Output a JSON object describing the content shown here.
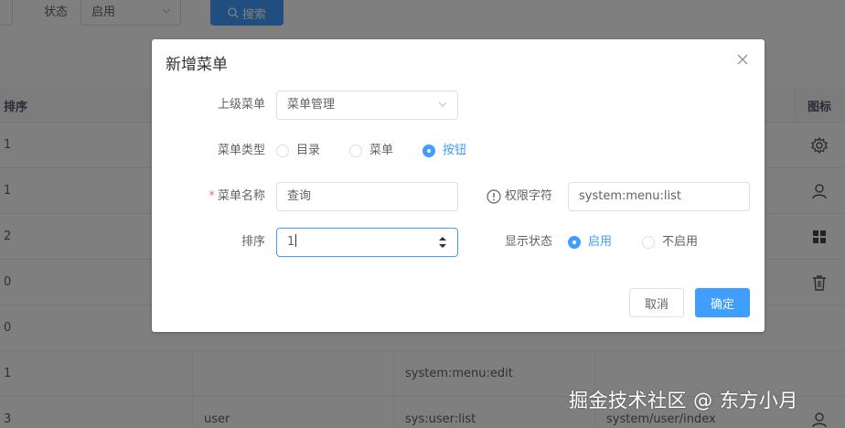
{
  "filter": {
    "status_label": "状态",
    "status_value": "启用",
    "search_label": "搜索"
  },
  "table": {
    "headers": {
      "order": "排序",
      "icon": "图标"
    },
    "rows": [
      {
        "order": "1",
        "c2": "",
        "c3": "",
        "c4": "",
        "icon": "gear-icon"
      },
      {
        "order": "1",
        "c2": "",
        "c3": "",
        "c4": "",
        "icon": "user-icon"
      },
      {
        "order": "2",
        "c2": "",
        "c3": "",
        "c4": "",
        "icon": "grid-icon"
      },
      {
        "order": "0",
        "c2": "",
        "c3": "",
        "c4": "",
        "icon": "trash-icon"
      },
      {
        "order": "0",
        "c2": "",
        "c3": "",
        "c4": "",
        "icon": ""
      },
      {
        "order": "1",
        "c2": "",
        "c3": "system:menu:edit",
        "c4": "",
        "icon": ""
      },
      {
        "order": "3",
        "c2": "user",
        "c3": "sys:user:list",
        "c4": "system/user/index",
        "icon": "user-icon"
      }
    ]
  },
  "dialog": {
    "title": "新增菜单",
    "parent_label": "上级菜单",
    "parent_value": "菜单管理",
    "type_label": "菜单类型",
    "type_options": [
      "目录",
      "菜单",
      "按钮"
    ],
    "type_selected": "按钮",
    "name_label": "菜单名称",
    "name_required_mark": "*",
    "name_value": "查询",
    "perm_label": "权限字符",
    "perm_value": "system:menu:list",
    "order_label": "排序",
    "order_value": "1",
    "visible_label": "显示状态",
    "visible_options": [
      "启用",
      "不启用"
    ],
    "visible_selected": "启用",
    "cancel_label": "取消",
    "ok_label": "确定"
  },
  "watermark": "掘金技术社区 @ 东方小月",
  "colors": {
    "primary": "#409eff",
    "required": "#f56c6c",
    "border": "#dcdfe6"
  }
}
